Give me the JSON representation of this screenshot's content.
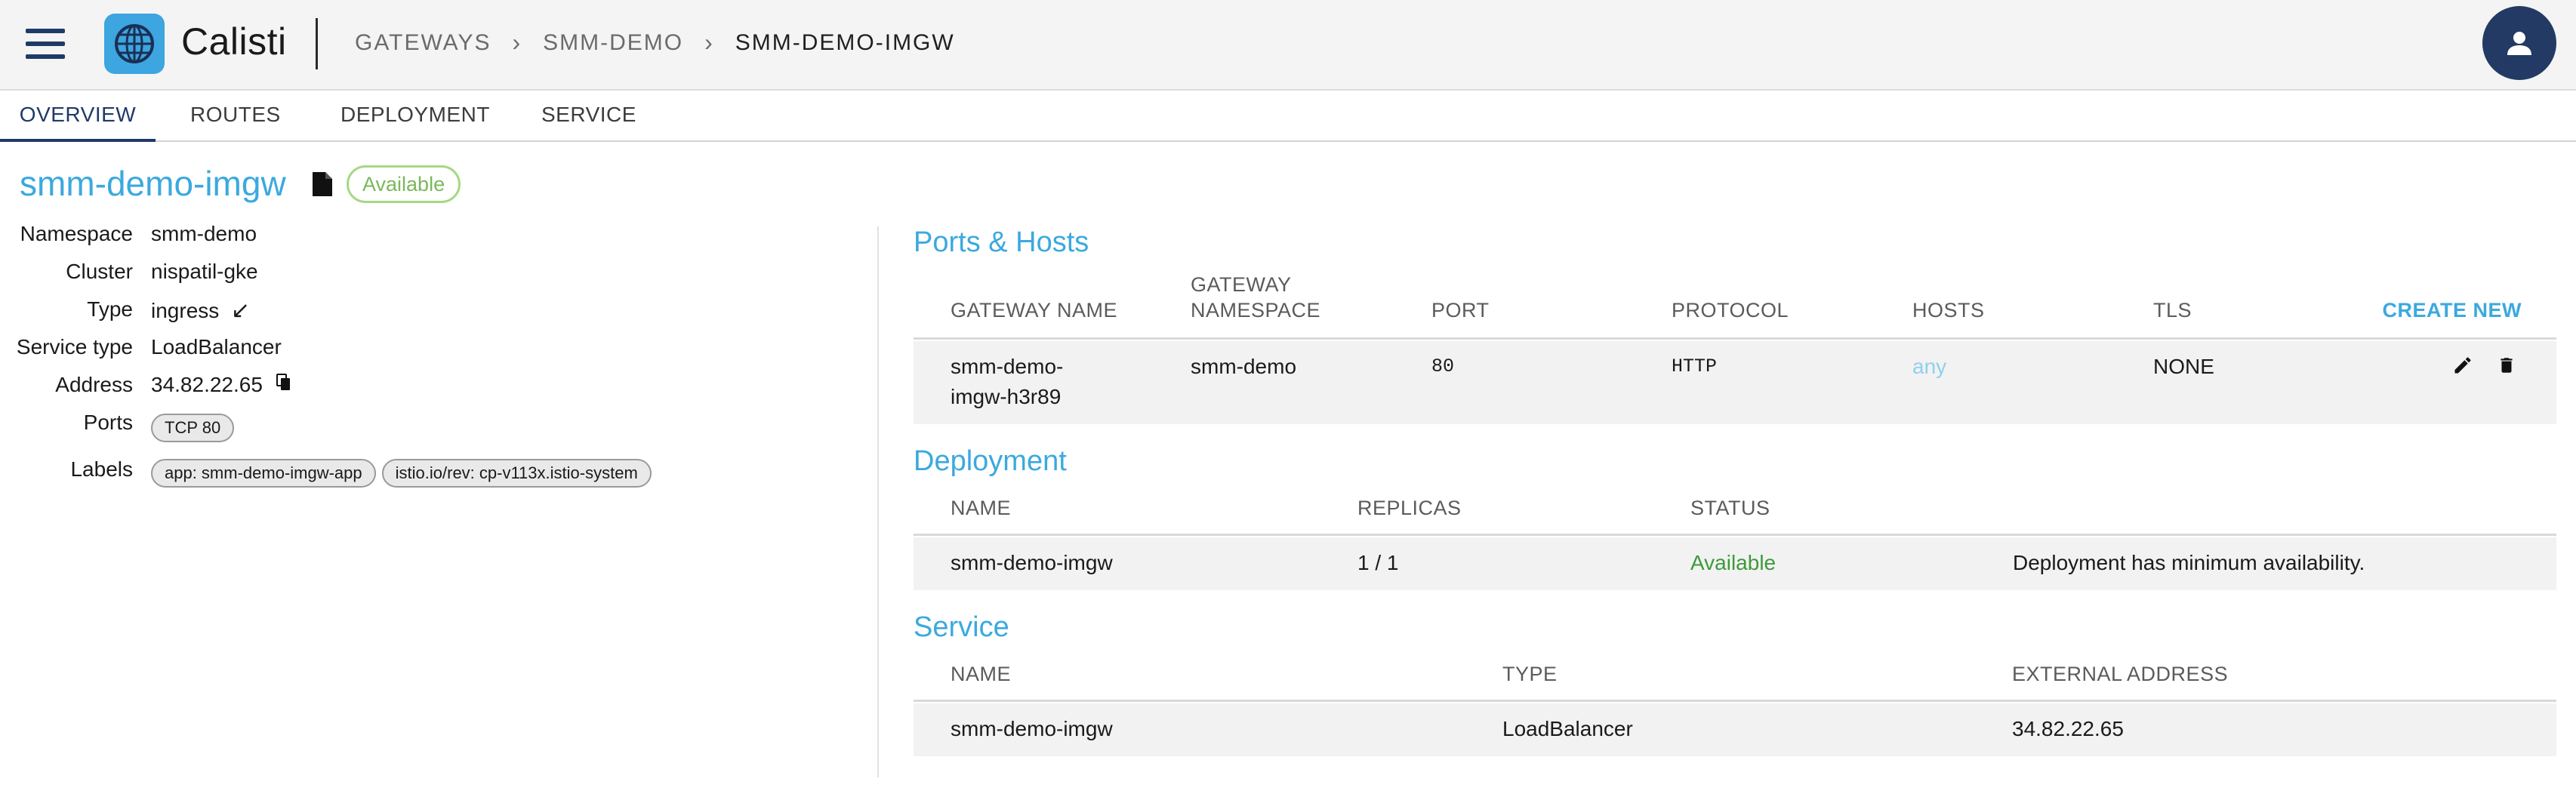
{
  "header": {
    "app_name": "Calisti",
    "breadcrumbs": [
      "GATEWAYS",
      "SMM-DEMO",
      "SMM-DEMO-IMGW"
    ],
    "breadcrumb_separator": "›"
  },
  "tabs": [
    {
      "label": "OVERVIEW",
      "active": true
    },
    {
      "label": "ROUTES"
    },
    {
      "label": "DEPLOYMENT"
    },
    {
      "label": "SERVICE"
    }
  ],
  "resource": {
    "name": "smm-demo-imgw",
    "status": "Available"
  },
  "details": {
    "namespace": {
      "label": "Namespace",
      "value": "smm-demo"
    },
    "cluster": {
      "label": "Cluster",
      "value": "nispatil-gke"
    },
    "type": {
      "label": "Type",
      "value": "ingress",
      "icon": "↙"
    },
    "service_type": {
      "label": "Service type",
      "value": "LoadBalancer"
    },
    "address": {
      "label": "Address",
      "value": "34.82.22.65"
    },
    "ports": {
      "label": "Ports",
      "chips": [
        "TCP 80"
      ]
    },
    "labels": {
      "label": "Labels",
      "chips": [
        "app: smm-demo-imgw-app",
        "istio.io/rev: cp-v113x.istio-system"
      ]
    }
  },
  "ports_hosts": {
    "title": "Ports & Hosts",
    "headers": {
      "gateway_name": "GATEWAY NAME",
      "gateway_namespace_line1": "GATEWAY",
      "gateway_namespace_line2": "NAMESPACE",
      "port": "PORT",
      "protocol": "PROTOCOL",
      "hosts": "HOSTS",
      "tls": "TLS",
      "create_new": "CREATE NEW"
    },
    "rows": [
      {
        "gateway_name_line1": "smm-demo-",
        "gateway_name_line2": "imgw-h3r89",
        "namespace": "smm-demo",
        "port": "80",
        "protocol": "HTTP",
        "hosts": "any",
        "tls": "NONE"
      }
    ]
  },
  "deployment": {
    "title": "Deployment",
    "headers": {
      "name": "NAME",
      "replicas": "REPLICAS",
      "status": "STATUS"
    },
    "rows": [
      {
        "name": "smm-demo-imgw",
        "replicas": "1 / 1",
        "status": "Available",
        "message": "Deployment has minimum availability."
      }
    ]
  },
  "service": {
    "title": "Service",
    "headers": {
      "name": "NAME",
      "type": "TYPE",
      "external_address": "EXTERNAL ADDRESS"
    },
    "rows": [
      {
        "name": "smm-demo-imgw",
        "type": "LoadBalancer",
        "external_address": "34.82.22.65"
      }
    ]
  },
  "colors": {
    "accent": "#3ba9de",
    "brand_navy": "#1f3a68",
    "status_green": "#3d9a3a",
    "available_badge": "#a6d884"
  }
}
